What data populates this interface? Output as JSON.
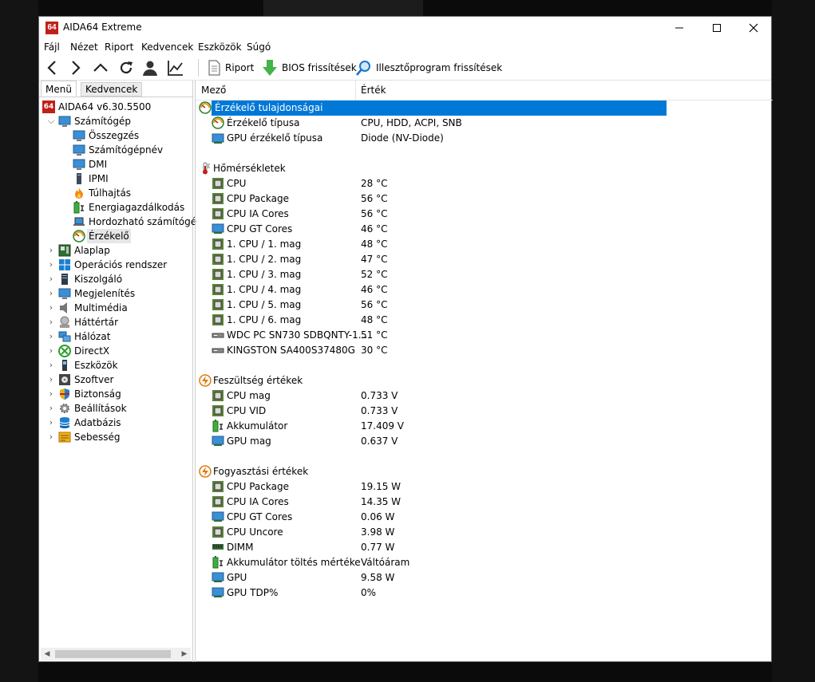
{
  "window": {
    "title": "AIDA64 Extreme",
    "icon_text": "64",
    "controls": [
      "minimize-icon",
      "maximize-icon",
      "close-icon"
    ]
  },
  "menu": [
    "Fájl",
    "Nézet",
    "Riport",
    "Kedvencek",
    "Eszközök",
    "Súgó"
  ],
  "toolbar": {
    "nav_icons": [
      "back-icon",
      "forward-icon",
      "up-icon",
      "refresh-icon",
      "user-icon",
      "chart-icon"
    ],
    "report_label": "Riport",
    "bios_label": "BIOS frissítések",
    "driver_label": "Illesztőprogram frissítések"
  },
  "left_panel": {
    "tabs": [
      "Menü",
      "Kedvencek"
    ],
    "root": "AIDA64 v6.30.5500",
    "computer": "Számítógép",
    "computer_children": [
      "Összegzés",
      "Számítógépnév",
      "DMI",
      "IPMI",
      "Túlhajtás",
      "Energiagazdálkodás",
      "Hordozható számítógé",
      "Érzékelő"
    ],
    "other_nodes": [
      "Alaplap",
      "Operációs rendszer",
      "Kiszolgáló",
      "Megjelenítés",
      "Multimédia",
      "Háttértár",
      "Hálózat",
      "DirectX",
      "Eszközök",
      "Szoftver",
      "Biztonság",
      "Beállítások",
      "Adatbázis",
      "Sebesség"
    ]
  },
  "right_panel": {
    "columns": [
      "Mező",
      "Érték"
    ],
    "sections": [
      {
        "title": "Érzékelő tulajdonságai",
        "rows": [
          {
            "field": "Érzékelő típusa",
            "value": "CPU, HDD, ACPI, SNB"
          },
          {
            "field": "GPU érzékelő típusa",
            "value": "Diode  (NV-Diode)"
          }
        ]
      },
      {
        "title": "Hőmérsékletek",
        "rows": [
          {
            "field": "CPU",
            "value": "28 °C"
          },
          {
            "field": "CPU Package",
            "value": "56 °C"
          },
          {
            "field": "CPU IA Cores",
            "value": "56 °C"
          },
          {
            "field": "CPU GT Cores",
            "value": "46 °C"
          },
          {
            "field": "1. CPU / 1. mag",
            "value": "48 °C"
          },
          {
            "field": "1. CPU / 2. mag",
            "value": "47 °C"
          },
          {
            "field": "1. CPU / 3. mag",
            "value": "52 °C"
          },
          {
            "field": "1. CPU / 4. mag",
            "value": "46 °C"
          },
          {
            "field": "1. CPU / 5. mag",
            "value": "56 °C"
          },
          {
            "field": "1. CPU / 6. mag",
            "value": "48 °C"
          },
          {
            "field": "WDC PC SN730 SDBQNTY-1...",
            "value": "51 °C"
          },
          {
            "field": "KINGSTON SA400S37480G",
            "value": "30 °C"
          }
        ]
      },
      {
        "title": "Feszültség értékek",
        "rows": [
          {
            "field": "CPU mag",
            "value": "0.733 V"
          },
          {
            "field": "CPU VID",
            "value": "0.733 V"
          },
          {
            "field": "Akkumulátor",
            "value": "17.409 V"
          },
          {
            "field": "GPU mag",
            "value": "0.637 V"
          }
        ]
      },
      {
        "title": "Fogyasztási értékek",
        "rows": [
          {
            "field": "CPU Package",
            "value": "19.15 W"
          },
          {
            "field": "CPU IA Cores",
            "value": "14.35 W"
          },
          {
            "field": "CPU GT Cores",
            "value": "0.06 W"
          },
          {
            "field": "CPU Uncore",
            "value": "3.98 W"
          },
          {
            "field": "DIMM",
            "value": "0.77 W"
          },
          {
            "field": "Akkumulátor töltés mértéke",
            "value": "Váltóáram"
          },
          {
            "field": "GPU",
            "value": "9.58 W"
          },
          {
            "field": "GPU TDP%",
            "value": "0%"
          }
        ]
      }
    ]
  },
  "colors": {
    "selection": "#0078d7",
    "app_icon": "#c0201b",
    "chip_green": "#5b7f3a",
    "monitor_blue": "#3a8fd6"
  }
}
